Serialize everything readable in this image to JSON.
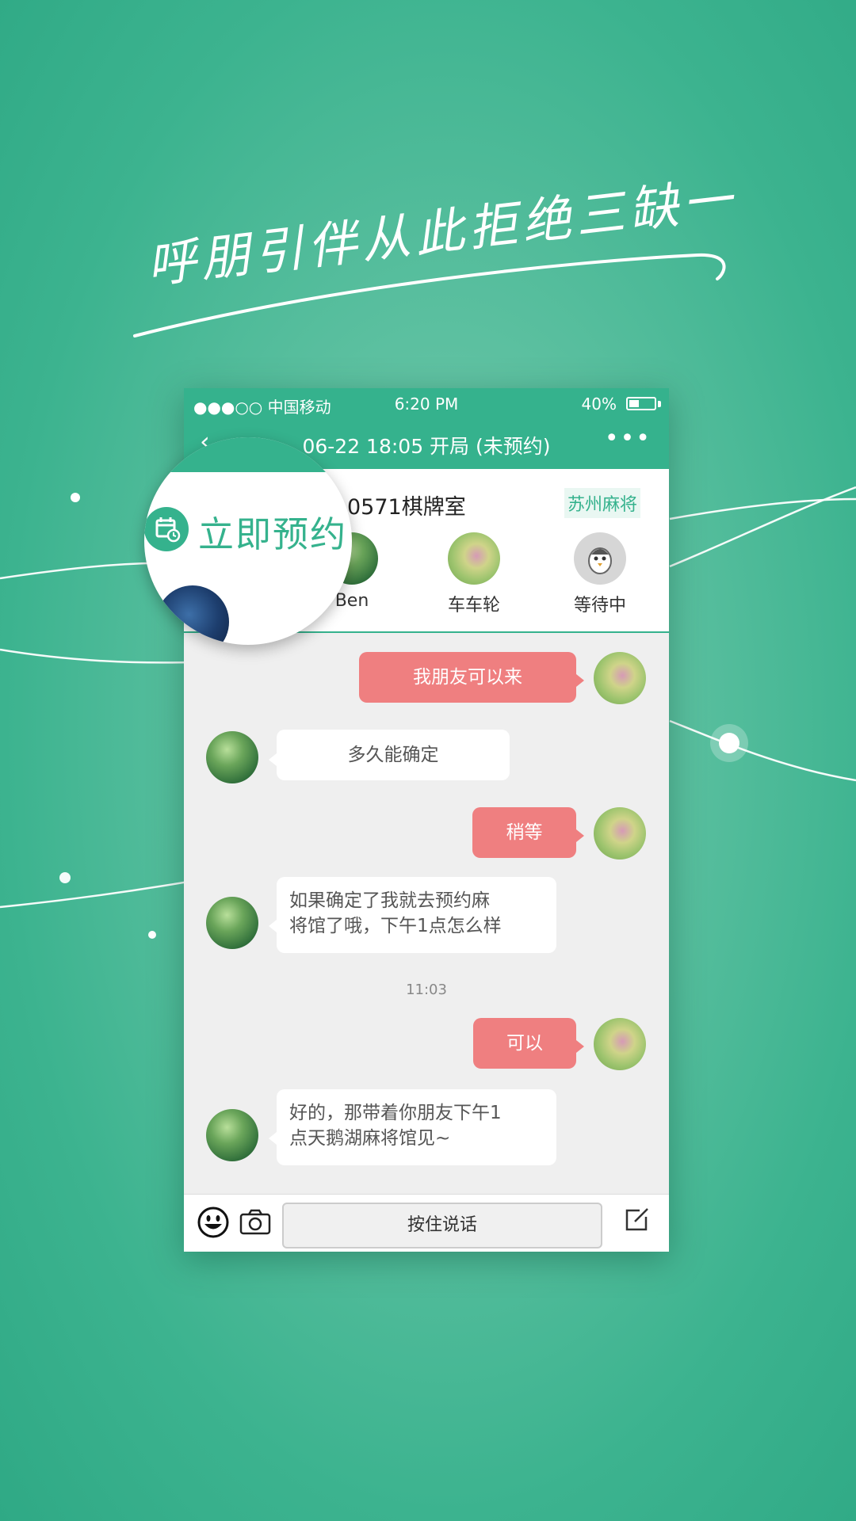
{
  "slogan": "呼朋引伴从此拒绝三缺一",
  "status_bar": {
    "signal": "●●●○○ 中国移动",
    "time": "6:20 PM",
    "battery": "40%",
    "battery_level": 0.4
  },
  "nav": {
    "back_icon": "chevron-left-icon",
    "title": "06-22 18:05 开局 (未预约)",
    "more_icon": "more-dots-icon",
    "more_label": "•••"
  },
  "room": {
    "name": "0571棋牌室",
    "game_tag": "苏州麻将"
  },
  "members": [
    {
      "name": "Ben"
    },
    {
      "name": "车车轮"
    },
    {
      "name": "等待中"
    }
  ],
  "magnifier": {
    "action_label": "立即预约",
    "icon": "calendar-icon"
  },
  "messages": [
    {
      "side": "out",
      "text": "我朋友可以来"
    },
    {
      "side": "in",
      "text": "多久能确定"
    },
    {
      "side": "out",
      "text": "稍等"
    },
    {
      "side": "in",
      "lines": [
        "如果确定了我就去预约麻",
        "将馆了哦，下午1点怎么样"
      ]
    },
    {
      "side": "time",
      "text": "11:03"
    },
    {
      "side": "out",
      "text": "可以"
    },
    {
      "side": "in",
      "lines": [
        "好的，那带着你朋友下午1",
        "点天鹅湖麻将馆见~"
      ]
    }
  ],
  "input_bar": {
    "emoji_icon": "emoji-icon",
    "camera_icon": "camera-icon",
    "voice_label": "按住说话",
    "edit_icon": "edit-icon"
  },
  "colors": {
    "accent": "#35b28d",
    "outgoing_bubble": "#ef7f80",
    "chat_bg": "#efefef"
  }
}
